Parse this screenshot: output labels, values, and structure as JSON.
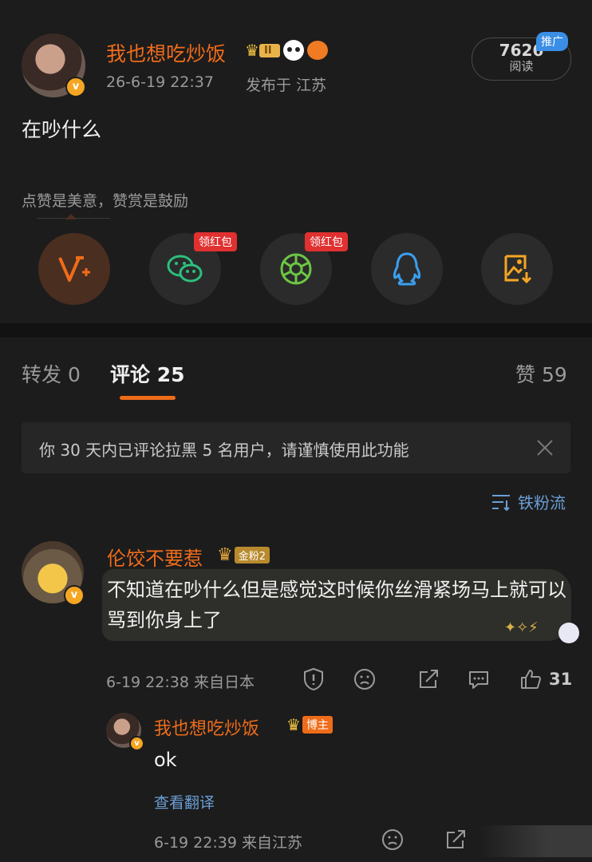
{
  "post": {
    "author": "我也想吃炒饭",
    "timestamp": "26-6-19 22:37",
    "location": "发布于 江苏",
    "reads_count": "7626",
    "reads_label": "阅读",
    "promo_label": "推广",
    "content": "在吵什么",
    "reward_text": "点赞是美意，赞赏是鼓励",
    "share_buttons": [
      {
        "icon": "v-plus-icon",
        "color": "#ef6c1a"
      },
      {
        "icon": "wechat-icon",
        "color": "#2bc07e",
        "tag": "领红包"
      },
      {
        "icon": "moments-icon",
        "color": "#6cc644",
        "tag": "领红包"
      },
      {
        "icon": "qq-icon",
        "color": "#3a9ff0"
      },
      {
        "icon": "save-image-icon",
        "color": "#f5a623"
      }
    ],
    "level_badge": "II"
  },
  "tabs": {
    "repost": "转发 0",
    "comments": "评论 25",
    "likes": "赞 59"
  },
  "notice": {
    "text": "你 30 天内已评论拉黑 5 名用户，请谨慎使用此功能"
  },
  "sort": {
    "label": "铁粉流"
  },
  "comment": {
    "author": "伦饺不要惹",
    "fan_badge": "金粉2",
    "text": "不知道在吵什么但是感觉这时候你丝滑紧场马上就可以骂到你身上了",
    "meta": "6-19 22:38 来自日本",
    "like_count": "31"
  },
  "reply": {
    "author": "我也想吃炒饭",
    "badge": "博主",
    "text": "ok",
    "translate": "查看翻译",
    "meta": "6-19 22:39 来自江苏"
  },
  "colors": {
    "accent": "#ef6c1a",
    "link": "#6b9ed6",
    "background": "#1c1c1c"
  }
}
